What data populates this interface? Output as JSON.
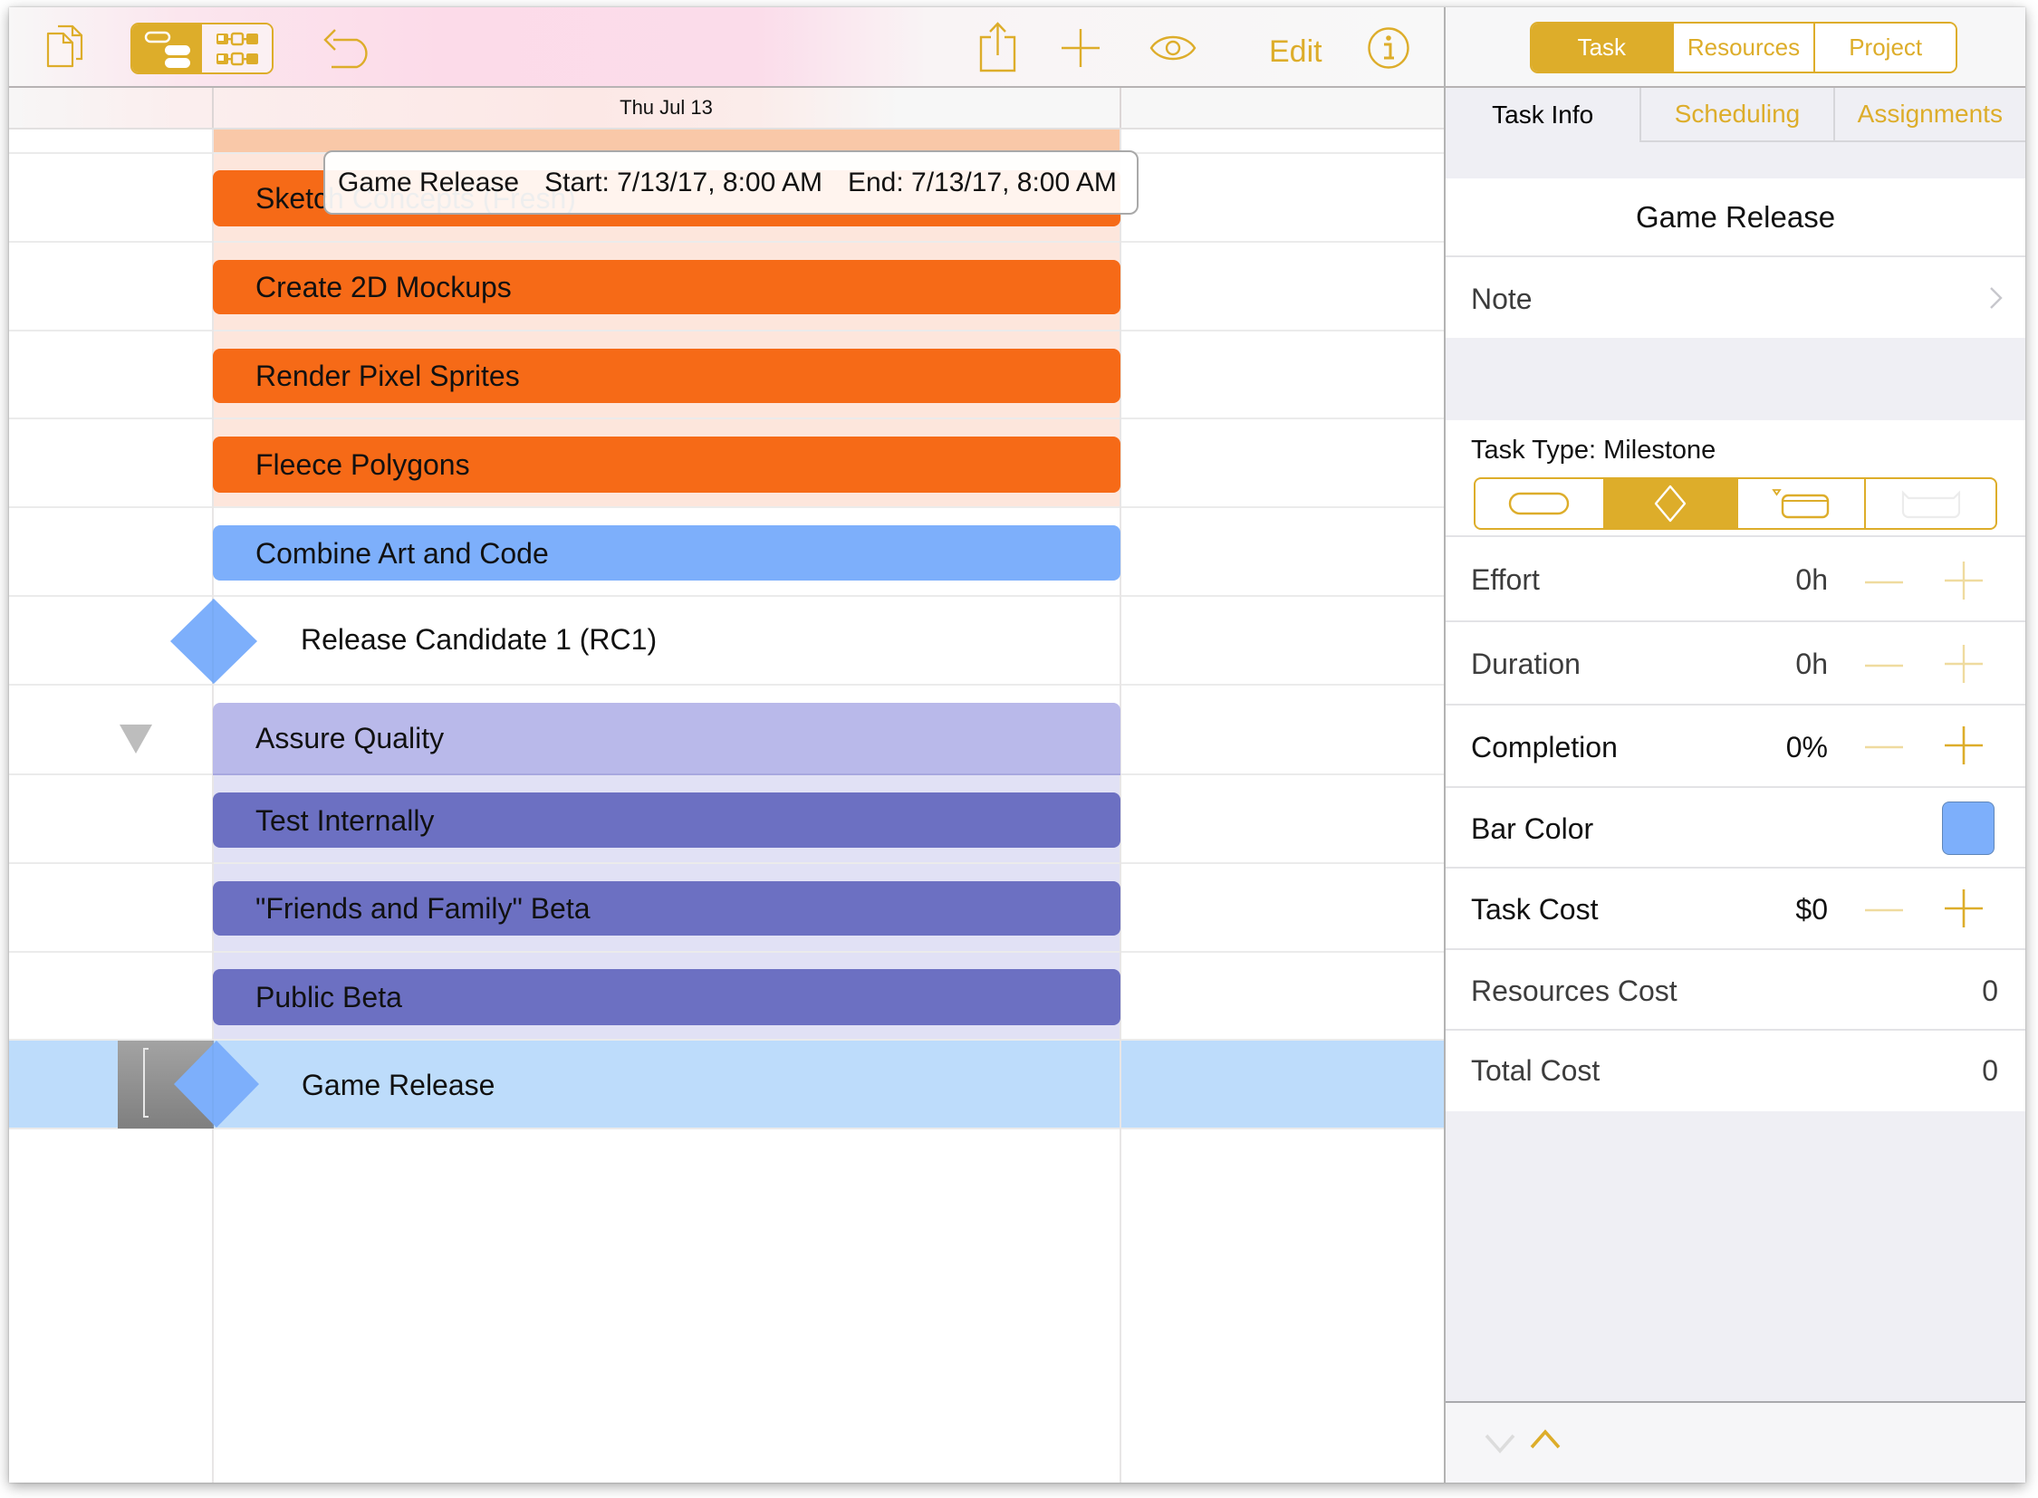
{
  "toolbar": {
    "documents_icon": "documents-icon",
    "view_modes": [
      {
        "name": "outline-gantt-view",
        "icon": "gantt-bars-icon",
        "active": true
      },
      {
        "name": "network-view",
        "icon": "network-icon",
        "active": false
      }
    ],
    "undo_icon": "undo-arrow-icon",
    "share_icon": "share-icon",
    "add_icon": "plus-icon",
    "view_options_icon": "eye-icon",
    "edit_label": "Edit",
    "info_icon": "info-icon",
    "accent_color": "#ddad2a"
  },
  "gantt": {
    "date_header": "Thu Jul 13",
    "tooltip": {
      "task": "Game Release",
      "start": "Start: 7/13/17, 8:00 AM",
      "end": "End: 7/13/17, 8:00 AM"
    },
    "rows": [
      {
        "kind": "group-bar-partial",
        "label": "",
        "color": "#f9c8a8"
      },
      {
        "kind": "bar",
        "label": "Sketch Concepts (Fresh)",
        "color": "#f66a17"
      },
      {
        "kind": "bar",
        "label": "Create 2D Mockups",
        "color": "#f66a17"
      },
      {
        "kind": "bar",
        "label": "Render Pixel Sprites",
        "color": "#f66a17"
      },
      {
        "kind": "bar",
        "label": "Fleece Polygons",
        "color": "#f66a17"
      },
      {
        "kind": "bar",
        "label": "Combine Art and Code",
        "color": "#7daffb"
      },
      {
        "kind": "milestone",
        "label": "Release Candidate 1 (RC1)",
        "color": "#7daffb"
      },
      {
        "kind": "group-bar",
        "label": "Assure Quality",
        "color": "#b9b9ea",
        "expanded": true
      },
      {
        "kind": "bar",
        "label": "Test Internally",
        "color": "#6c70c2"
      },
      {
        "kind": "bar",
        "label": "\"Friends and Family\" Beta",
        "color": "#6c70c2"
      },
      {
        "kind": "bar",
        "label": "Public Beta",
        "color": "#6c70c2"
      },
      {
        "kind": "milestone",
        "label": "Game Release",
        "color": "#7daffb",
        "selected": true
      }
    ],
    "group_band_colors": {
      "art": "#fde6dc",
      "qa": "#e1e1f5"
    },
    "selection_color": "#bddcfb"
  },
  "inspector": {
    "kind_tabs": [
      {
        "label": "Task",
        "active": true
      },
      {
        "label": "Resources",
        "active": false
      },
      {
        "label": "Project",
        "active": false
      }
    ],
    "sub_tabs": [
      {
        "label": "Task Info",
        "active": true
      },
      {
        "label": "Scheduling",
        "active": false
      },
      {
        "label": "Assignments",
        "active": false
      }
    ],
    "title": "Game Release",
    "note_label": "Note",
    "task_type_label": "Task Type: Milestone",
    "task_types": [
      {
        "name": "task",
        "icon": "task-bar-icon",
        "active": false
      },
      {
        "name": "milestone",
        "icon": "milestone-diamond-icon",
        "active": true
      },
      {
        "name": "group",
        "icon": "group-bar-icon",
        "active": false
      },
      {
        "name": "hammock",
        "icon": "hammock-bar-icon",
        "active": false,
        "disabled": true
      }
    ],
    "fields": {
      "effort": {
        "label": "Effort",
        "value": "0h"
      },
      "duration": {
        "label": "Duration",
        "value": "0h"
      },
      "completion": {
        "label": "Completion",
        "value": "0%"
      },
      "bar_color": {
        "label": "Bar Color",
        "value": "#7daffb"
      },
      "task_cost": {
        "label": "Task Cost",
        "value": "$0"
      },
      "resources_cost": {
        "label": "Resources Cost",
        "value": "0"
      },
      "total_cost": {
        "label": "Total Cost",
        "value": "0"
      }
    },
    "bottom_nav": {
      "previous_icon": "chevron-down-icon",
      "next_icon": "chevron-up-icon"
    }
  }
}
